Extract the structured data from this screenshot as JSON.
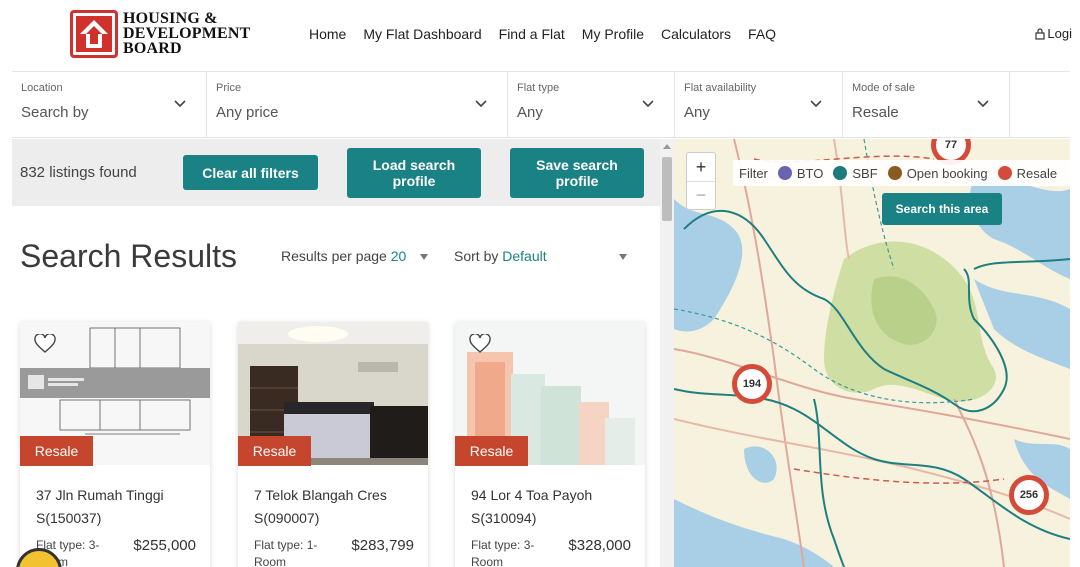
{
  "header": {
    "logo_lines": [
      "HOUSING &",
      "DEVELOPMENT",
      "BOARD"
    ],
    "nav": [
      "Home",
      "My Flat Dashboard",
      "Find a Flat",
      "My Profile",
      "Calculators",
      "FAQ"
    ],
    "login_label": "Logi"
  },
  "filters": [
    {
      "label": "Location",
      "value": "Search by"
    },
    {
      "label": "Price",
      "value": "Any price"
    },
    {
      "label": "Flat type",
      "value": "Any"
    },
    {
      "label": "Flat availability",
      "value": "Any"
    },
    {
      "label": "Mode of sale",
      "value": "Resale"
    }
  ],
  "toolbar": {
    "count": "832 listings found",
    "clear_label": "Clear all filters",
    "load_label": "Load search profile",
    "save_label": "Save search profile"
  },
  "results": {
    "title": "Search Results",
    "per_page_label": "Results per page",
    "per_page_value": "20",
    "sort_label": "Sort by",
    "sort_value": "Default"
  },
  "listings": [
    {
      "badge": "Resale",
      "address": "37 Jln Rumah Tinggi",
      "postal": "S(150037)",
      "flat_type": "Flat type: 3-",
      "flat_type_cont": "Room",
      "price": "$255,000"
    },
    {
      "badge": "Resale",
      "address": "7 Telok Blangah Cres",
      "postal": "S(090007)",
      "flat_type": "Flat type: 1-",
      "flat_type_cont": "Room",
      "price": "$283,799"
    },
    {
      "badge": "Resale",
      "address": "94 Lor 4 Toa Payoh",
      "postal": "S(310094)",
      "flat_type": "Flat type: 3-",
      "flat_type_cont": "Room",
      "price": "$328,000"
    }
  ],
  "map": {
    "zoom_in": "+",
    "zoom_out": "−",
    "filter_label": "Filter",
    "legend": [
      {
        "name": "BTO",
        "color": "#6a64b0"
      },
      {
        "name": "SBF",
        "color": "#1a7a7c"
      },
      {
        "name": "Open booking",
        "color": "#8a5a1e"
      },
      {
        "name": "Resale",
        "color": "#d44b3a"
      }
    ],
    "search_area_label": "Search this area",
    "clusters": [
      "77",
      "194",
      "256"
    ]
  },
  "colors": {
    "accent": "#1a8285",
    "resale": "#c6452d",
    "brand_red": "#d0312d"
  }
}
